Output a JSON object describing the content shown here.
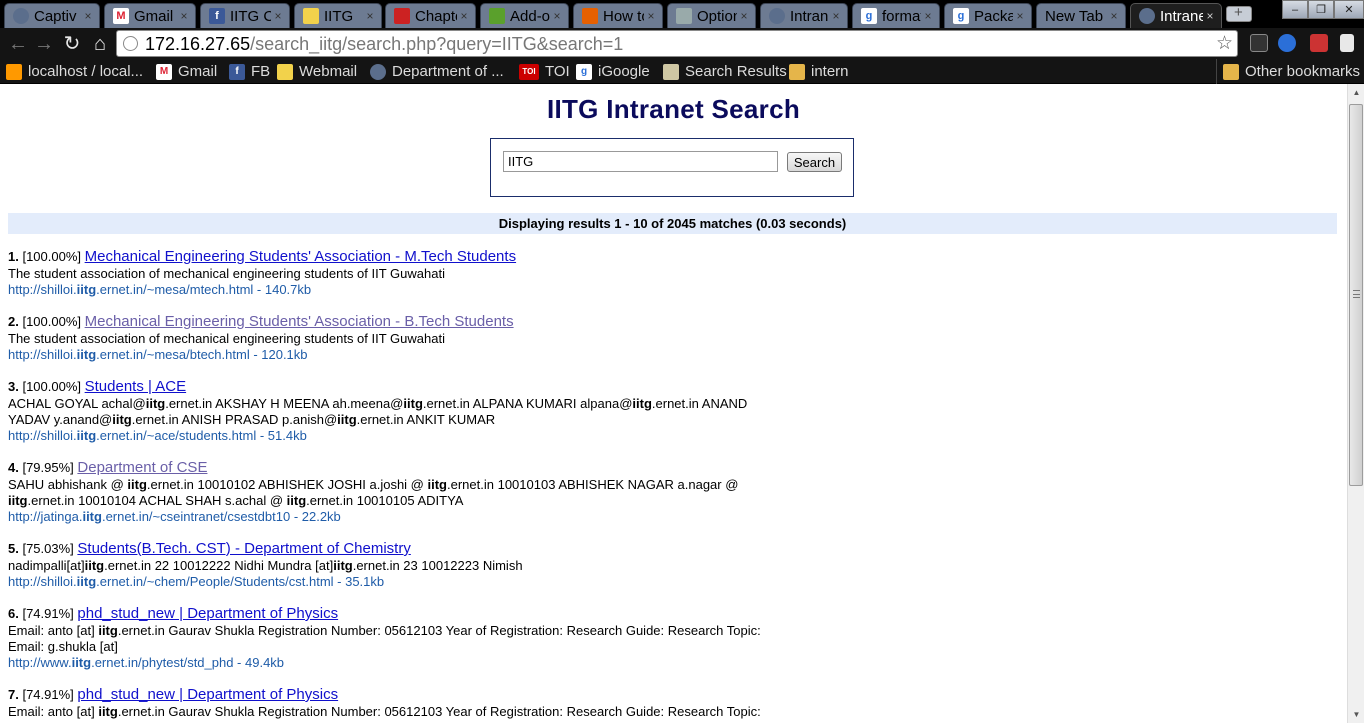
{
  "browser": {
    "tabs": [
      {
        "title": "Captiv",
        "icon": "globe-icon"
      },
      {
        "title": "Gmail",
        "icon": "gmail-icon"
      },
      {
        "title": "IITG CS",
        "icon": "facebook-icon"
      },
      {
        "title": "IITG",
        "icon": "iitg-icon"
      },
      {
        "title": "Chapte",
        "icon": "bug-icon"
      },
      {
        "title": "Add-o",
        "icon": "puzzle-icon"
      },
      {
        "title": "How to",
        "icon": "firefox-icon"
      },
      {
        "title": "Option",
        "icon": "wrench-icon"
      },
      {
        "title": "Intrane",
        "icon": "globe-icon"
      },
      {
        "title": "format",
        "icon": "google-icon"
      },
      {
        "title": "Packag",
        "icon": "google-icon"
      },
      {
        "title": "New Tab",
        "icon": ""
      },
      {
        "title": "Intrane",
        "icon": "globe-icon",
        "active": true
      }
    ],
    "url": {
      "host": "172.16.27.65",
      "path": "/search_iitg/search.php?query=IITG&search=1"
    },
    "bookmarks": [
      {
        "label": "localhost / local...",
        "icon": "pma-icon"
      },
      {
        "label": "Gmail",
        "icon": "gmail-icon"
      },
      {
        "label": "FB",
        "icon": "facebook-icon"
      },
      {
        "label": "Webmail",
        "icon": "iitg-icon"
      },
      {
        "label": "Department of ...",
        "icon": "globe-icon"
      },
      {
        "label": "TOI",
        "icon": "toi-icon"
      },
      {
        "label": "iGoogle",
        "icon": "google-icon"
      },
      {
        "label": "Search Results",
        "icon": "page-icon"
      },
      {
        "label": "intern",
        "icon": "folder-icon"
      }
    ],
    "other_bookmarks": "Other bookmarks"
  },
  "page": {
    "title": "IITG Intranet Search",
    "search": {
      "value": "IITG",
      "button": "Search"
    },
    "results_header": "Displaying results 1 - 10 of 2045 matches (0.03 seconds)",
    "results": [
      {
        "num": "1.",
        "score": "[100.00%]",
        "title": "Mechanical Engineering Students' Association - M.Tech Students",
        "visited": false,
        "desc": "The student association of mechanical engineering students of IIT Guwahati",
        "url_pre": "http://shilloi.",
        "url_hl": "iitg",
        "url_post": ".ernet.in/~mesa/mtech.html - 140.7kb"
      },
      {
        "num": "2.",
        "score": "[100.00%]",
        "title": "Mechanical Engineering Students' Association - B.Tech Students",
        "visited": true,
        "desc": "The student association of mechanical engineering students of IIT Guwahati",
        "url_pre": "http://shilloi.",
        "url_hl": "iitg",
        "url_post": ".ernet.in/~mesa/btech.html - 120.1kb"
      },
      {
        "num": "3.",
        "score": "[100.00%]",
        "title": "Students | ACE",
        "visited": false,
        "desc": "ACHAL GOYAL achal@**iitg**.ernet.in AKSHAY H MEENA ah.meena@**iitg**.ernet.in ALPANA KUMARI alpana@**iitg**.ernet.in ANAND YADAV y.anand@**iitg**.ernet.in ANISH PRASAD p.anish@**iitg**.ernet.in ANKIT KUMAR",
        "url_pre": "http://shilloi.",
        "url_hl": "iitg",
        "url_post": ".ernet.in/~ace/students.html - 51.4kb"
      },
      {
        "num": "4.",
        "score": "[79.95%]",
        "title": "Department of CSE",
        "visited": true,
        "desc": "SAHU abhishank @ **iitg**.ernet.in 10010102 ABHISHEK JOSHI a.joshi @ **iitg**.ernet.in 10010103 ABHISHEK NAGAR a.nagar @ **iitg**.ernet.in 10010104 ACHAL SHAH s.achal @ **iitg**.ernet.in 10010105 ADITYA",
        "url_pre": "http://jatinga.",
        "url_hl": "iitg",
        "url_post": ".ernet.in/~cseintranet/csestdbt10 - 22.2kb"
      },
      {
        "num": "5.",
        "score": "[75.03%]",
        "title": "Students(B.Tech. CST) - Department of Chemistry",
        "visited": false,
        "desc": "nadimpalli[at]**iitg**.ernet.in 22 10012222 Nidhi Mundra [at]**iitg**.ernet.in 23 10012223 Nimish",
        "url_pre": "http://shilloi.",
        "url_hl": "iitg",
        "url_post": ".ernet.in/~chem/People/Students/cst.html - 35.1kb"
      },
      {
        "num": "6.",
        "score": "[74.91%]",
        "title": "phd_stud_new | Department of Physics",
        "visited": false,
        "desc": "Email: anto [at] **iitg**.ernet.in Gaurav Shukla Registration Number: 05612103 Year of Registration: Research Guide: Research Topic: Email: g.shukla [at]",
        "url_pre": "http://www.",
        "url_hl": "iitg",
        "url_post": ".ernet.in/phytest/std_phd - 49.4kb"
      },
      {
        "num": "7.",
        "score": "[74.91%]",
        "title": "phd_stud_new | Department of Physics",
        "visited": false,
        "desc": "Email: anto [at] **iitg**.ernet.in Gaurav Shukla Registration Number: 05612103 Year of Registration: Research Guide: Research Topic:",
        "url_pre": "",
        "url_hl": "",
        "url_post": ""
      }
    ]
  },
  "colors": {
    "title": "#0b0b5c",
    "link": "#1010cc",
    "visited": "#6a5fa8",
    "url": "#1f5ca8",
    "header_bg": "#e3ecfb"
  }
}
